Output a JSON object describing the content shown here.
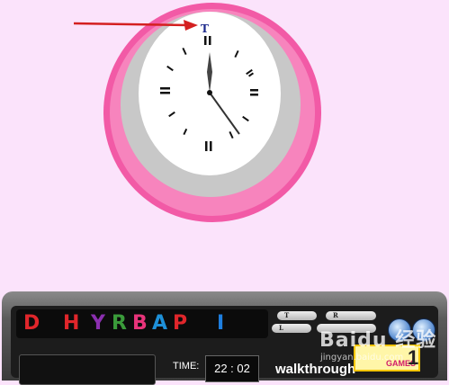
{
  "clock": {
    "top_letter": "T",
    "hour_hand_time": "12",
    "minute_hand_minutes": 22
  },
  "hud": {
    "letters": [
      {
        "char": "D",
        "color": "#e0262b"
      },
      {
        "char": "H",
        "color": "#e0262b"
      },
      {
        "char": "Y",
        "color": "#8b2fb0"
      },
      {
        "char": "R",
        "color": "#3a9b3a"
      },
      {
        "char": "B",
        "color": "#e8347a"
      },
      {
        "char": "A",
        "color": "#1e90d8"
      },
      {
        "char": "P",
        "color": "#e0262b"
      },
      {
        "char": "I",
        "color": "#1e7fe0"
      }
    ],
    "slots": [
      "T",
      "R",
      "L",
      ""
    ],
    "time_label": "TIME:",
    "time_value": "22 : 02",
    "walkthrough_label": "walkthrough",
    "logo_text": "GAMES",
    "logo_number": "1"
  },
  "watermark": {
    "text": "Baidu 经验",
    "sub": "jingyan.baidu.com"
  },
  "colors": {
    "background": "#fbe3fb",
    "clock_outer_ring": "#f25aa6",
    "clock_inner_ring": "#c8c8c8",
    "clock_face": "#ffffff",
    "arrow": "#d42020"
  }
}
